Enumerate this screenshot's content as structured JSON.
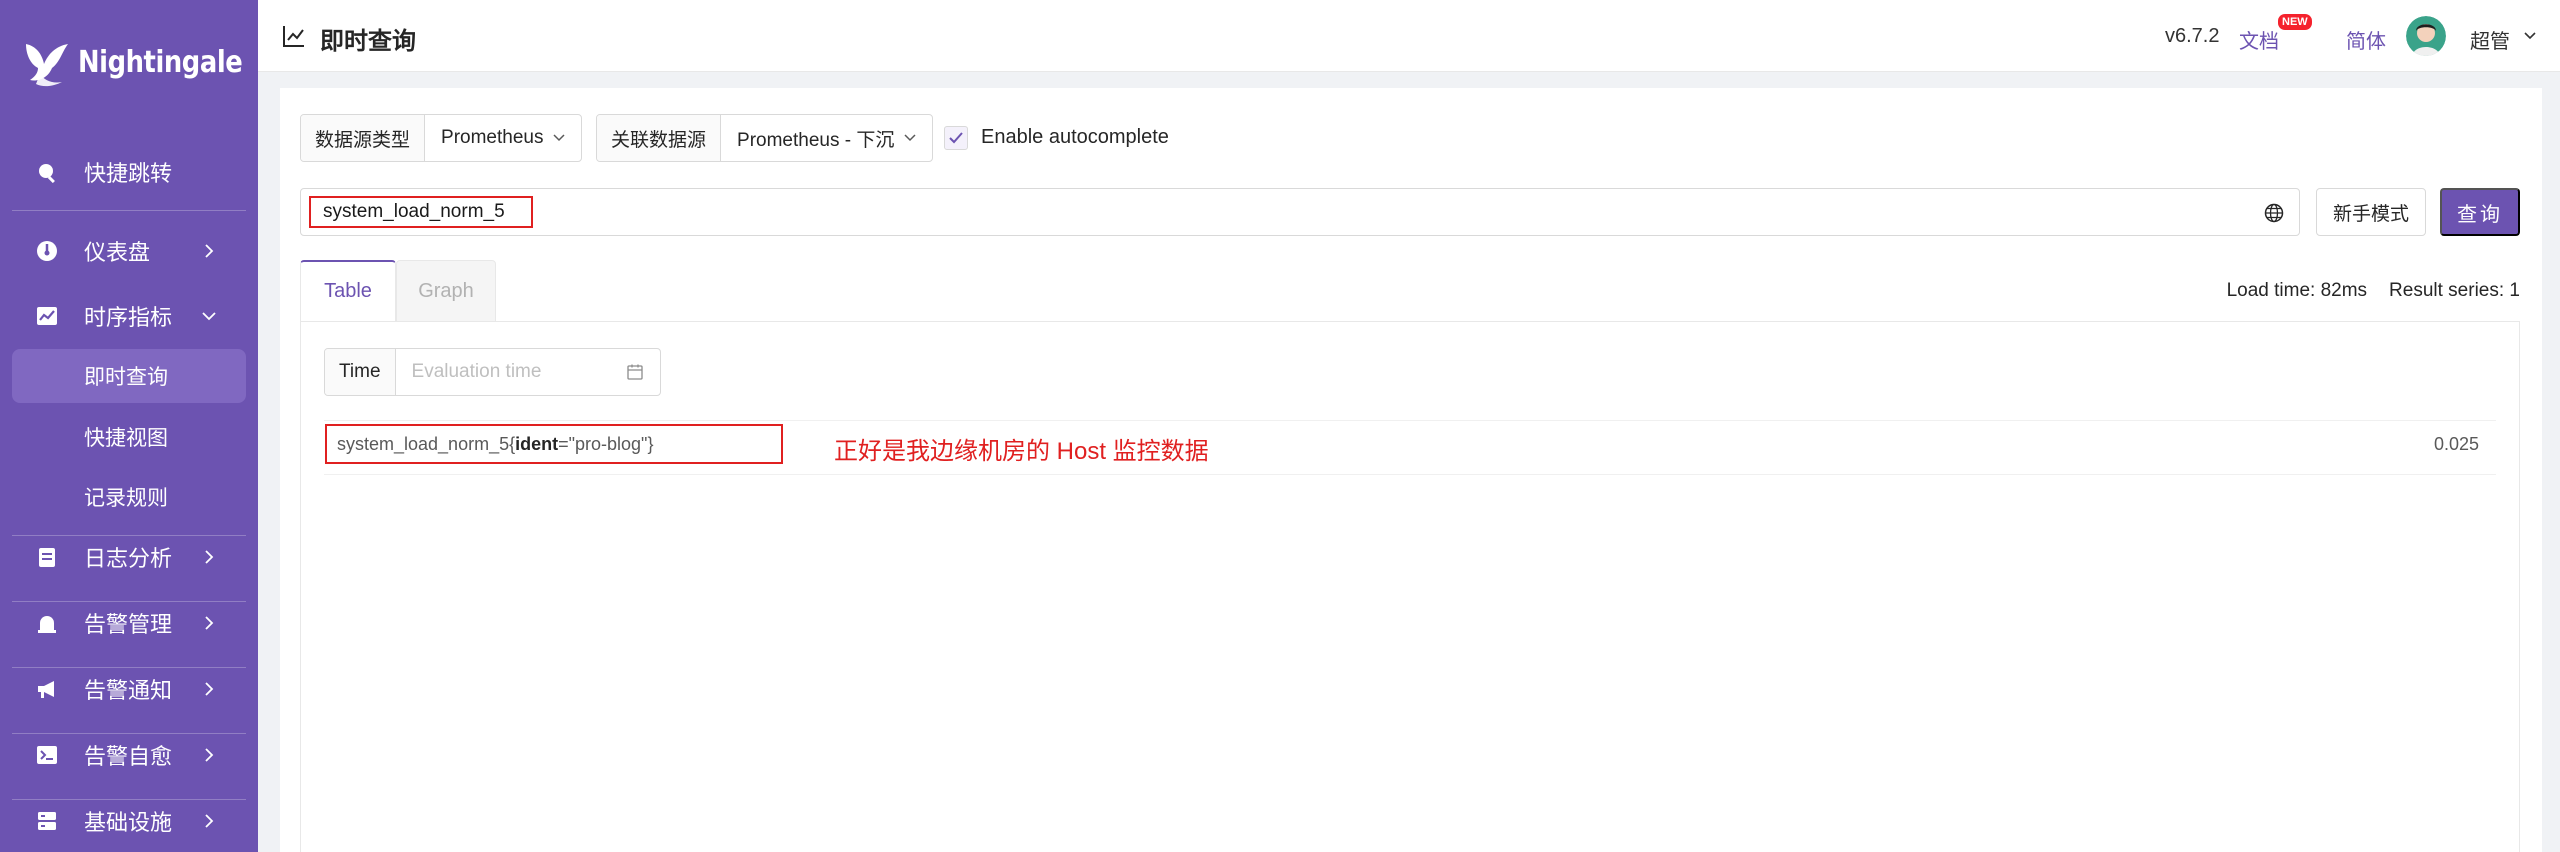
{
  "app": {
    "logo_text": "Nightingale"
  },
  "sidebar": {
    "items": [
      {
        "label": "快捷跳转",
        "icon": "search-icon"
      },
      {
        "label": "仪表盘",
        "icon": "dashboard-icon"
      },
      {
        "label": "时序指标",
        "icon": "line-chart-icon",
        "expanded": true
      },
      {
        "label": "日志分析",
        "icon": "document-icon"
      },
      {
        "label": "告警管理",
        "icon": "alarm-icon"
      },
      {
        "label": "告警通知",
        "icon": "megaphone-icon"
      },
      {
        "label": "告警自愈",
        "icon": "terminal-icon"
      },
      {
        "label": "基础设施",
        "icon": "server-icon"
      }
    ],
    "sub_items": [
      {
        "label": "即时查询",
        "active": true
      },
      {
        "label": "快捷视图"
      },
      {
        "label": "记录规则"
      }
    ]
  },
  "header": {
    "title": "即时查询",
    "version": "v6.7.2",
    "docs": "文档",
    "docs_badge": "NEW",
    "lang": "简体",
    "user": "超管"
  },
  "query_bar": {
    "datasource_type_label": "数据源类型",
    "datasource_type_value": "Prometheus",
    "datasource_label": "关联数据源",
    "datasource_value": "Prometheus - 下沉",
    "autocomplete_label": "Enable autocomplete",
    "autocomplete_checked": true,
    "query": "system_load_norm_5",
    "novice_button": "新手模式",
    "query_button": "查询"
  },
  "tabs": [
    {
      "label": "Table",
      "active": true
    },
    {
      "label": "Graph",
      "active": false
    }
  ],
  "stats": {
    "load_time": "Load time: 82ms",
    "result_series": "Result series: 1"
  },
  "time": {
    "label": "Time",
    "placeholder": "Evaluation time"
  },
  "results": [
    {
      "metric": "system_load_norm_5{",
      "label_key": "ident",
      "label_eq": "=\"pro-blog\"}",
      "value": "0.025"
    }
  ],
  "annotation": "正好是我边缘机房的 Host 监控数据",
  "colors": {
    "primary": "#6c53b1",
    "highlight": "#e02020"
  }
}
